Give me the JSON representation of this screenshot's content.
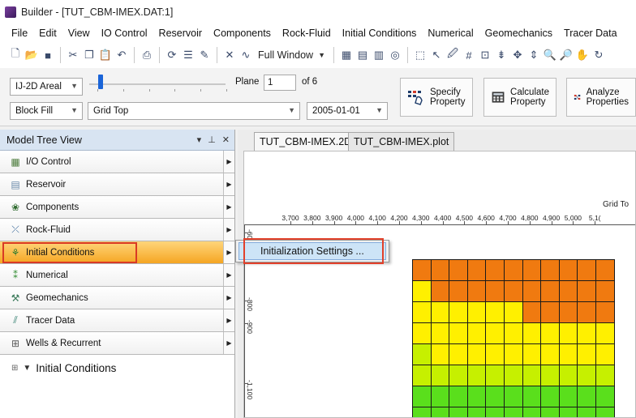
{
  "window": {
    "title": "Builder - [TUT_CBM-IMEX.DAT:1]"
  },
  "menu": [
    "File",
    "Edit",
    "View",
    "IO Control",
    "Reservoir",
    "Components",
    "Rock-Fluid",
    "Initial Conditions",
    "Numerical",
    "Geomechanics",
    "Tracer Data"
  ],
  "toolbar": {
    "view_mode": "Full Window"
  },
  "controls": {
    "view_type": "IJ-2D Areal",
    "display_mode": "Block Fill",
    "property": "Grid Top",
    "plane_label": "Plane",
    "plane_value": "1",
    "plane_of": "of 6",
    "date": "2005-01-01",
    "slider_fraction": 0.0
  },
  "buttons": {
    "specify": [
      "Specify",
      "Property"
    ],
    "calculate": [
      "Calculate",
      "Property"
    ],
    "analyze": [
      "Analyze",
      "Properties"
    ]
  },
  "model_tree": {
    "title": "Model Tree View",
    "items": [
      {
        "label": "I/O Control",
        "icon": "io-control-icon"
      },
      {
        "label": "Reservoir",
        "icon": "reservoir-icon"
      },
      {
        "label": "Components",
        "icon": "components-icon"
      },
      {
        "label": "Rock-Fluid",
        "icon": "rock-fluid-icon"
      },
      {
        "label": "Initial Conditions",
        "icon": "initial-conditions-icon",
        "active": true
      },
      {
        "label": "Numerical",
        "icon": "numerical-icon"
      },
      {
        "label": "Geomechanics",
        "icon": "geomechanics-icon"
      },
      {
        "label": "Tracer Data",
        "icon": "tracer-data-icon"
      },
      {
        "label": "Wells & Recurrent",
        "icon": "wells-recurrent-icon"
      }
    ],
    "root_node": "Initial Conditions"
  },
  "submenu": {
    "item": "Initialization Settings ..."
  },
  "tabs": [
    "TUT_CBM-IMEX.2D",
    "TUT_CBM-IMEX.plot"
  ],
  "plot": {
    "title": "Grid To",
    "x_ticks": [
      "3,700",
      "3,800",
      "3,900",
      "4,000",
      "4,100",
      "4,200",
      "4,300",
      "4,400",
      "4,500",
      "4,600",
      "4,700",
      "4,800",
      "4,900",
      "5,000",
      "5,1("
    ],
    "y_ticks": [
      "-600",
      "-800",
      "-900",
      "-1,100"
    ],
    "colors": {
      "orange": "#f07a10",
      "yellow": "#fff000",
      "yellow_green": "#c6f000",
      "green": "#5adf1c",
      "green2": "#2dd21a"
    }
  }
}
